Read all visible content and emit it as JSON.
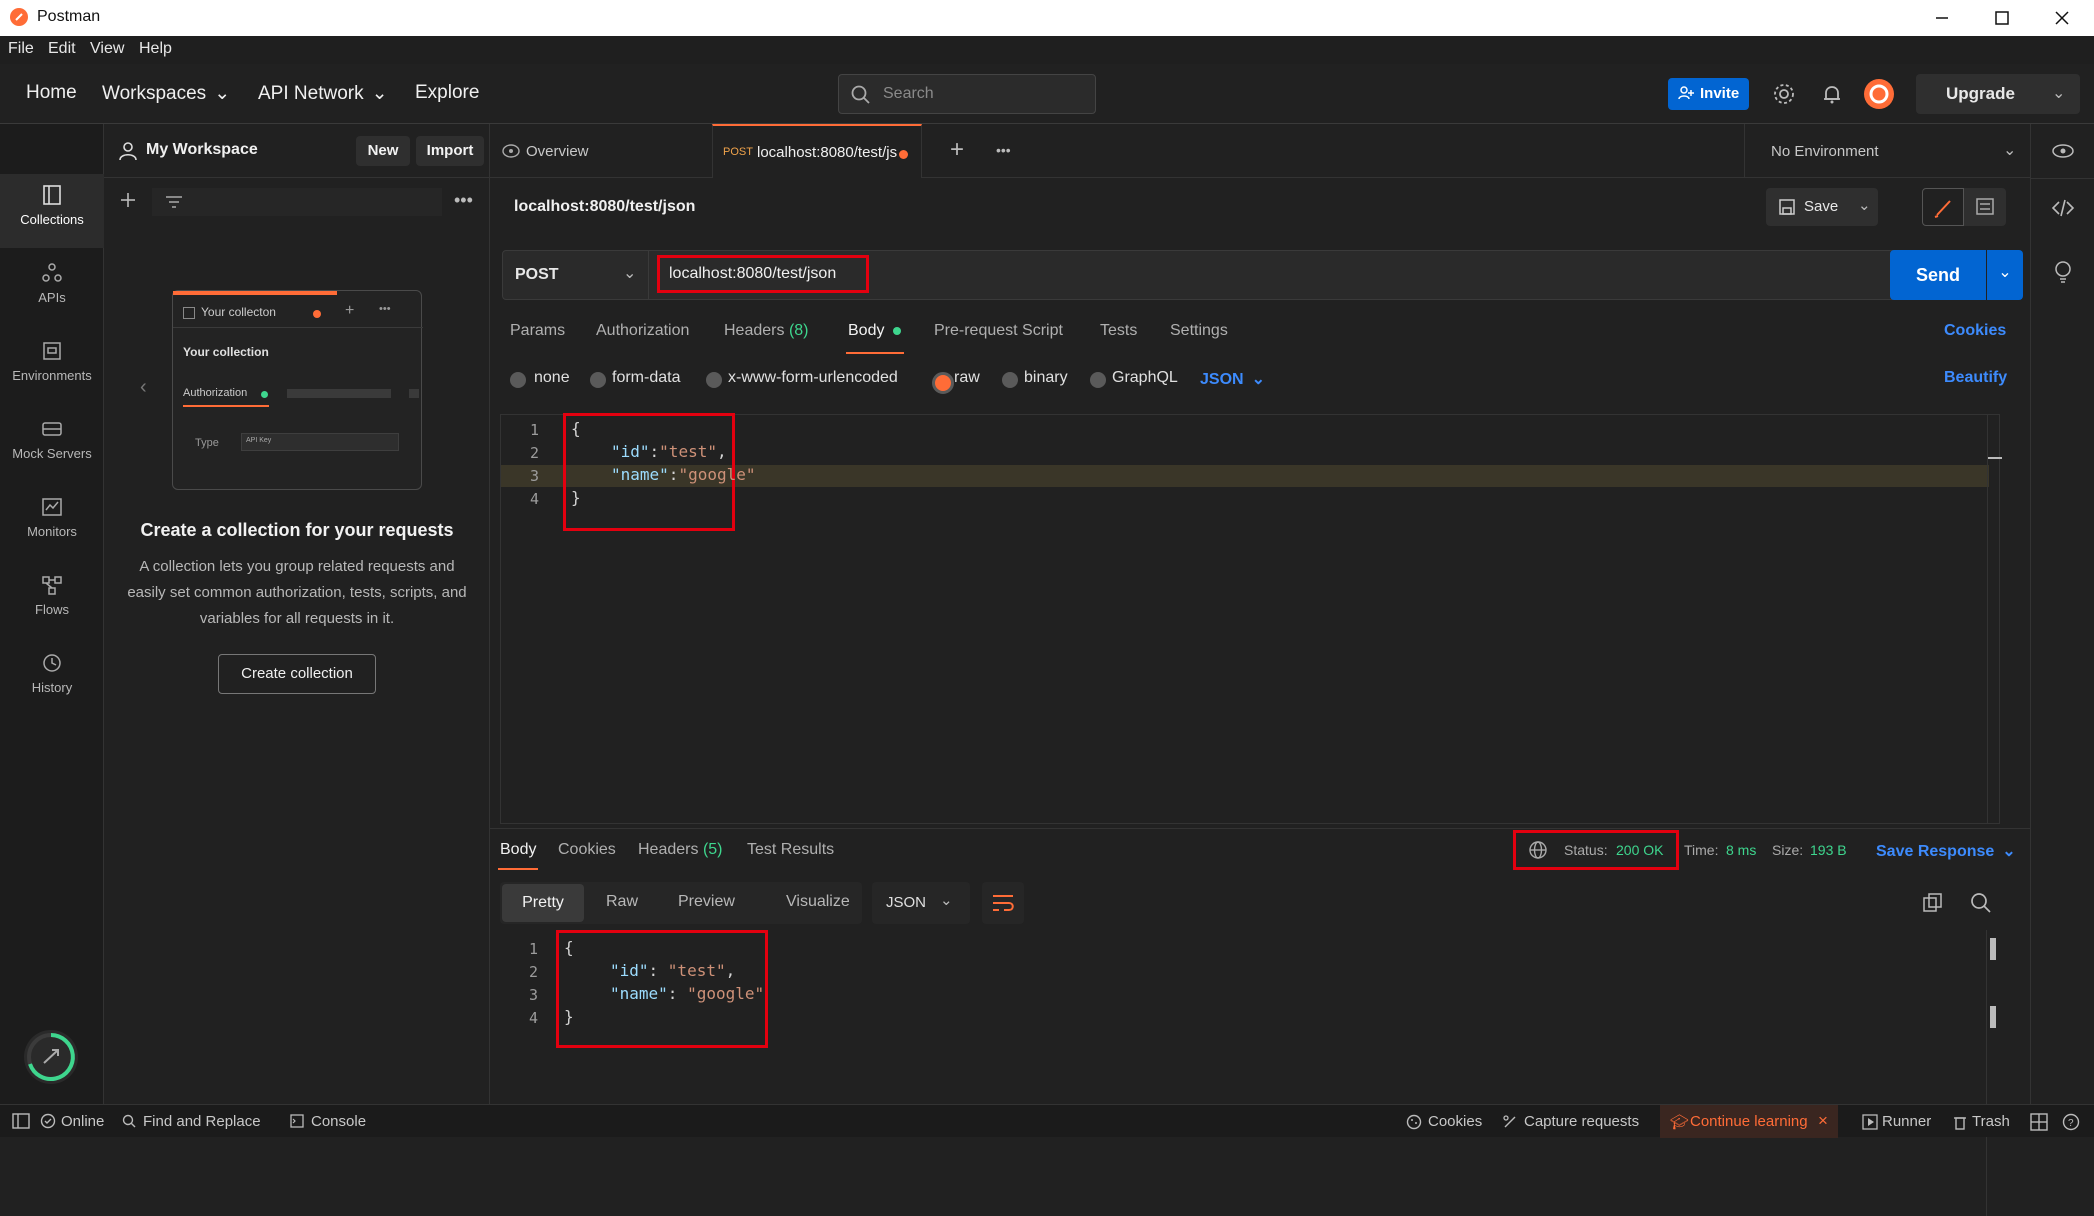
{
  "window": {
    "title": "Postman",
    "controls": [
      "minimize",
      "maximize",
      "close"
    ]
  },
  "menubar": [
    "File",
    "Edit",
    "View",
    "Help"
  ],
  "topnav": {
    "home": "Home",
    "workspaces": "Workspaces",
    "api_network": "API Network",
    "explore": "Explore",
    "search_placeholder": "Search",
    "invite": "Invite",
    "upgrade": "Upgrade"
  },
  "workspace": {
    "name": "My Workspace",
    "new": "New",
    "import": "Import"
  },
  "rail": [
    {
      "label": "Collections",
      "icon": "collections-icon"
    },
    {
      "label": "APIs",
      "icon": "apis-icon"
    },
    {
      "label": "Environments",
      "icon": "environments-icon"
    },
    {
      "label": "Mock Servers",
      "icon": "mock-servers-icon"
    },
    {
      "label": "Monitors",
      "icon": "monitors-icon"
    },
    {
      "label": "Flows",
      "icon": "flows-icon"
    },
    {
      "label": "History",
      "icon": "history-icon"
    }
  ],
  "empty_collection": {
    "illustration": {
      "title": "Your collecton",
      "subtitle": "Your collection",
      "tab": "Authorization",
      "type_label": "Type",
      "type_value": "API Key"
    },
    "heading": "Create a collection for your requests",
    "description": "A collection lets you group related requests and easily set common authorization, tests, scripts, and variables for all requests in it.",
    "button": "Create collection"
  },
  "tabs": {
    "overview": "Overview",
    "active_method": "POST",
    "active_label": "localhost:8080/test/js",
    "environment": "No Environment"
  },
  "request": {
    "name": "localhost:8080/test/json",
    "save": "Save",
    "method": "POST",
    "url": "localhost:8080/test/json",
    "send": "Send",
    "subtabs": [
      "Params",
      "Authorization",
      "Headers",
      "Body",
      "Pre-request Script",
      "Tests",
      "Settings"
    ],
    "headers_count": "(8)",
    "cookies": "Cookies",
    "body_types": [
      "none",
      "form-data",
      "x-www-form-urlencoded",
      "raw",
      "binary",
      "GraphQL"
    ],
    "body_format": "JSON",
    "beautify": "Beautify",
    "body_lines": [
      {
        "n": "1",
        "text": "{"
      },
      {
        "n": "2",
        "key": "\"id\"",
        "sep": ":",
        "value": "\"test\"",
        "end": ","
      },
      {
        "n": "3",
        "key": "\"name\"",
        "sep": ":",
        "value": "\"google\"",
        "end": ""
      },
      {
        "n": "4",
        "text": "}"
      }
    ]
  },
  "response": {
    "tabs": [
      "Body",
      "Cookies",
      "Headers",
      "Test Results"
    ],
    "headers_count": "(5)",
    "status_label": "Status:",
    "status_value": "200 OK",
    "time_label": "Time:",
    "time_value": "8 ms",
    "size_label": "Size:",
    "size_value": "193 B",
    "save_response": "Save Response",
    "views": [
      "Pretty",
      "Raw",
      "Preview",
      "Visualize"
    ],
    "format": "JSON",
    "body_lines": [
      {
        "n": "1",
        "text": "{"
      },
      {
        "n": "2",
        "key": "\"id\"",
        "sep": ": ",
        "value": "\"test\"",
        "end": ","
      },
      {
        "n": "3",
        "key": "\"name\"",
        "sep": ": ",
        "value": "\"google\"",
        "end": ""
      },
      {
        "n": "4",
        "text": "}"
      }
    ]
  },
  "statusbar": {
    "online": "Online",
    "find_replace": "Find and Replace",
    "console": "Console",
    "cookies": "Cookies",
    "capture": "Capture requests",
    "continue_learning": "Continue learning",
    "runner": "Runner",
    "trash": "Trash"
  },
  "colors": {
    "accent_orange": "#ff6c37",
    "primary_blue": "#0265d2",
    "status_green": "#3ed68e",
    "highlight_red": "#e3000f",
    "background": "#212121"
  }
}
